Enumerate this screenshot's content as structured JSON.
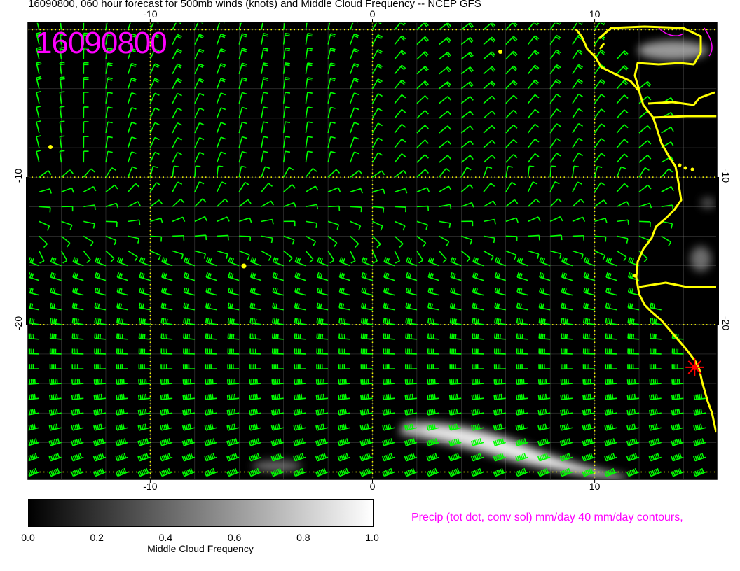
{
  "title": "16090800, 060 hour forecast for 500mb winds (knots) and Middle Cloud Frequency -- NCEP GFS",
  "date_stamp": "16090800",
  "precip_note": "Precip (tot dot, conv sol) mm/day 40 mm/day contours,",
  "colors": {
    "background": "#000000",
    "wind_barb": "#00ff00",
    "coastline": "#ffff00",
    "grid_major": "#ffff00",
    "grid_minor": "#808080",
    "stamp": "#ff00ff",
    "precip": "#ff00ff",
    "marker": "#ff0000"
  },
  "map": {
    "lon_range": [
      -15.5,
      15.5
    ],
    "lat_range": [
      -30.5,
      0.5
    ],
    "major_grid_lon": [
      -10,
      0,
      10
    ],
    "major_grid_lat": [
      -10,
      -20
    ],
    "top_ticks": [
      "-10",
      "0",
      "10"
    ],
    "bottom_ticks": [
      "-10",
      "0",
      "10"
    ],
    "left_ticks": [
      "-10",
      "-20"
    ],
    "right_ticks": [
      "-10",
      "-20"
    ],
    "marker_lon": 14.5,
    "marker_lat": -22.9
  },
  "colorbar": {
    "title": "Middle Cloud Frequency",
    "labels": [
      "0.0",
      "0.2",
      "0.4",
      "0.6",
      "0.8",
      "1.0"
    ]
  }
}
